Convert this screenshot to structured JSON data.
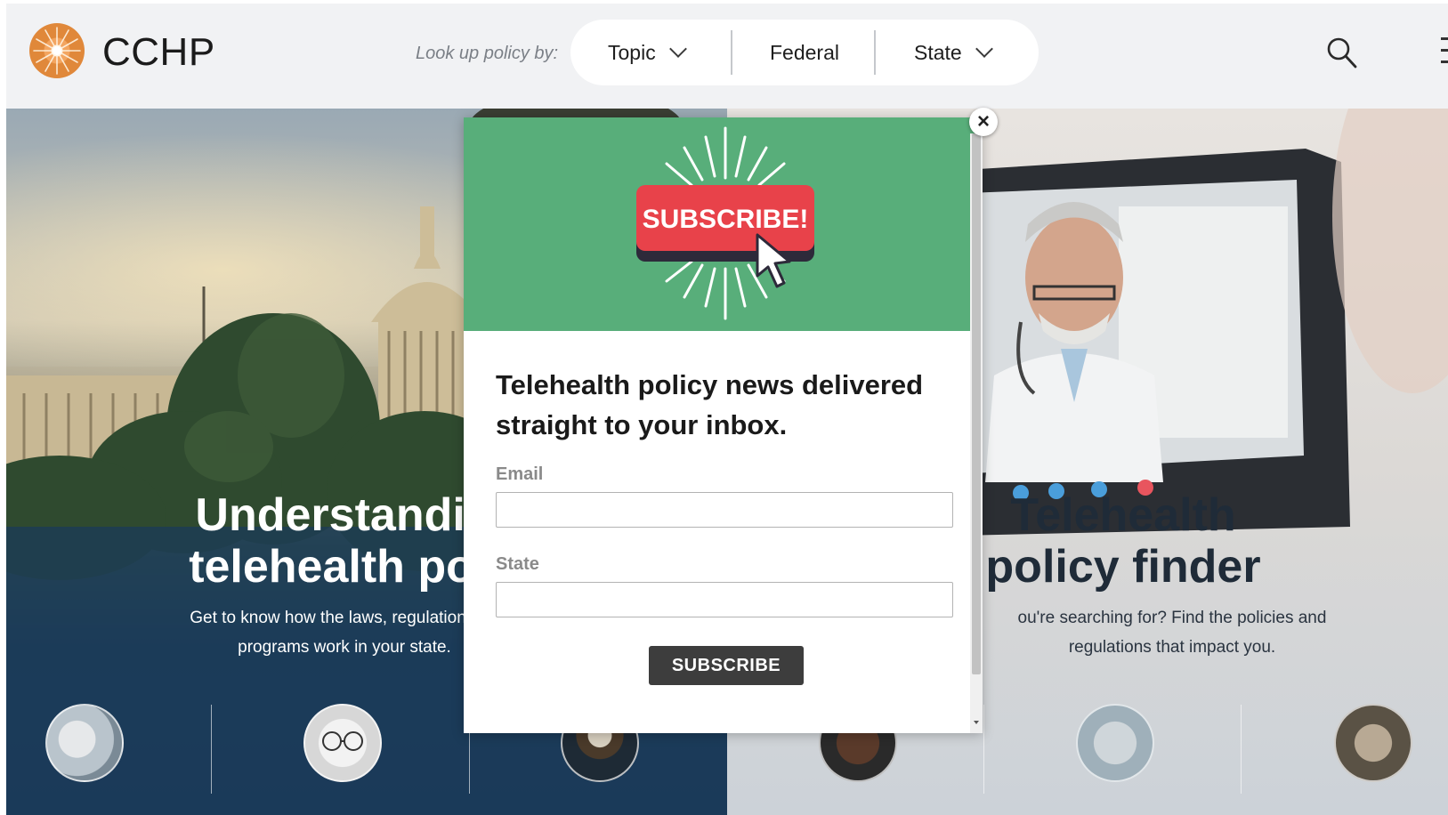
{
  "brand": {
    "name": "CCHP"
  },
  "nav": {
    "lookup_label": "Look up policy by:",
    "items": [
      "Topic",
      "Federal",
      "State"
    ]
  },
  "hero_left": {
    "title_line1": "Understandin",
    "title_line2": "telehealth poli",
    "sub_line1": "Get to know how the laws, regulations, ar",
    "sub_line2": "programs work in your state."
  },
  "hero_right": {
    "title_line1": "Telehealth",
    "title_line2": "policy finder",
    "sub_line1": "ou're searching for? Find the policies and",
    "sub_line2": "regulations that impact you."
  },
  "modal": {
    "banner_text": "SUBSCRIBE!",
    "heading": "Telehealth policy news delivered straight to your inbox.",
    "email_label": "Email",
    "email_value": "",
    "state_label": "State",
    "state_value": "",
    "button_label": "SUBSCRIBE",
    "close_symbol": "×"
  },
  "icons": {
    "search": "search-icon",
    "close": "close-icon",
    "chevron": "chevron-down-icon",
    "menu": "menu-icon"
  },
  "colors": {
    "banner_green": "#58ae7a",
    "banner_red": "#e8424a",
    "button_dark": "#3d3d3d",
    "logo_orange": "#e0883a"
  }
}
